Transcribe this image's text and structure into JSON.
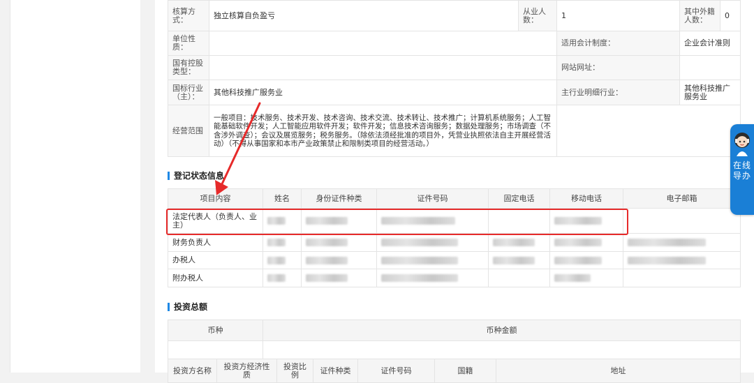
{
  "basic_info": {
    "accounting_method_label": "核算方式：",
    "accounting_method_value": "独立核算自负盈亏",
    "employees_label": "从业人数：",
    "employees_value": "1",
    "foreign_employees_label": "其中外籍人数：",
    "foreign_employees_value": "0",
    "unit_nature_label": "单位性质：",
    "unit_nature_value": "",
    "accounting_system_label": "适用会计制度：",
    "accounting_system_value": "企业会计准则",
    "state_holding_label": "国有控股类型：",
    "state_holding_value": "",
    "website_label": "网站网址：",
    "website_value": "",
    "industry_label": "国标行业（主）：",
    "industry_value": "其他科技推广服务业",
    "main_industry_detail_label": "主行业明细行业：",
    "main_industry_detail_value": "其他科技推广服务业",
    "business_scope_label": "经营范围",
    "business_scope_value": "一般项目：技术服务、技术开发、技术咨询、技术交流、技术转让、技术推广；计算机系统服务；人工智能基础软件开发；人工智能应用软件开发；软件开发；信息技术咨询服务；数据处理服务；市场调查（不含涉外调查）；会议及展览服务；税务服务。（除依法须经批准的项目外，凭营业执照依法自主开展经营活动）（不得从事国家和本市产业政策禁止和限制类项目的经营活动。）"
  },
  "registration": {
    "section_title": "登记状态信息",
    "headers": [
      "项目内容",
      "姓名",
      "身份证件种类",
      "证件号码",
      "固定电话",
      "移动电话",
      "电子邮箱"
    ],
    "rows": [
      {
        "item": "法定代表人（负责人、业主）"
      },
      {
        "item": "财务负责人"
      },
      {
        "item": "办税人"
      },
      {
        "item": "附办税人"
      }
    ]
  },
  "investment": {
    "section_title": "投资总额",
    "currency_header": "币种",
    "amount_header": "币种金额",
    "investor_headers": [
      "投资方名称",
      "投资方经济性质",
      "投资比例",
      "证件种类",
      "证件号码",
      "国籍",
      "地址"
    ]
  },
  "chat_widget": {
    "label": "在线导办",
    "accent_color": "#1a7fd6"
  },
  "highlight_color": "#e62a2a"
}
